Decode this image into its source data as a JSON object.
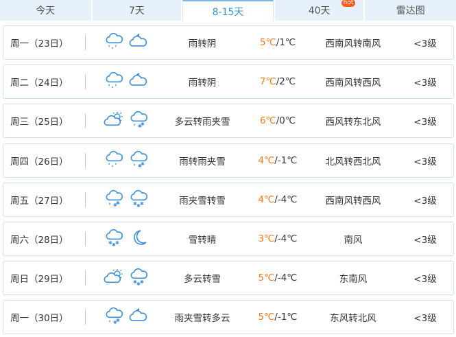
{
  "tabs": [
    {
      "label": "今天",
      "active": false,
      "badge": ""
    },
    {
      "label": "7天",
      "active": false,
      "badge": ""
    },
    {
      "label": "8-15天",
      "active": true,
      "badge": ""
    },
    {
      "label": "40天",
      "active": false,
      "badge": "hot"
    },
    {
      "label": "雷达图",
      "active": false,
      "badge": ""
    }
  ],
  "colors": {
    "accent": "#3f8fd6",
    "high_temp": "#ef7a1a",
    "tab_bg": "#e7f1fb",
    "border": "#cfe1f1",
    "icon": "#3a8fd8"
  },
  "forecast": [
    {
      "day": "周一（23日）",
      "icons": [
        "rain-icon",
        "cloudy-night-icon"
      ],
      "desc": "雨转阴",
      "high": "5℃",
      "low": "/1℃",
      "wind": "西南风转南风",
      "level": "<3级"
    },
    {
      "day": "周二（24日）",
      "icons": [
        "rain-icon",
        "cloudy-night-icon"
      ],
      "desc": "雨转阴",
      "high": "7℃",
      "low": "/2℃",
      "wind": "西南风转西风",
      "level": "<3级"
    },
    {
      "day": "周三（25日）",
      "icons": [
        "partly-cloudy-icon",
        "sleet-icon"
      ],
      "desc": "多云转雨夹雪",
      "high": "6℃",
      "low": "/0℃",
      "wind": "西风转东北风",
      "level": "<3级"
    },
    {
      "day": "周四（26日）",
      "icons": [
        "rain-icon",
        "sleet-icon"
      ],
      "desc": "雨转雨夹雪",
      "high": "4℃",
      "low": "/-1℃",
      "wind": "北风转西北风",
      "level": "<3级"
    },
    {
      "day": "周五（27日）",
      "icons": [
        "sleet-icon",
        "snow-icon"
      ],
      "desc": "雨夹雪转雪",
      "high": "4℃",
      "low": "/-4℃",
      "wind": "西南风转西风",
      "level": "<3级"
    },
    {
      "day": "周六（28日）",
      "icons": [
        "snow-icon",
        "moon-icon"
      ],
      "desc": "雪转晴",
      "high": "3℃",
      "low": "/-4℃",
      "wind": "南风",
      "level": "<3级"
    },
    {
      "day": "周日（29日）",
      "icons": [
        "partly-cloudy-icon",
        "snow-icon"
      ],
      "desc": "多云转雪",
      "high": "5℃",
      "low": "/-4℃",
      "wind": "东南风",
      "level": "<3级"
    },
    {
      "day": "周一（30日）",
      "icons": [
        "sleet-icon",
        "cloudy-night-icon"
      ],
      "desc": "雨夹雪转多云",
      "high": "5℃",
      "low": "/-1℃",
      "wind": "东风转北风",
      "level": "<3级"
    }
  ]
}
